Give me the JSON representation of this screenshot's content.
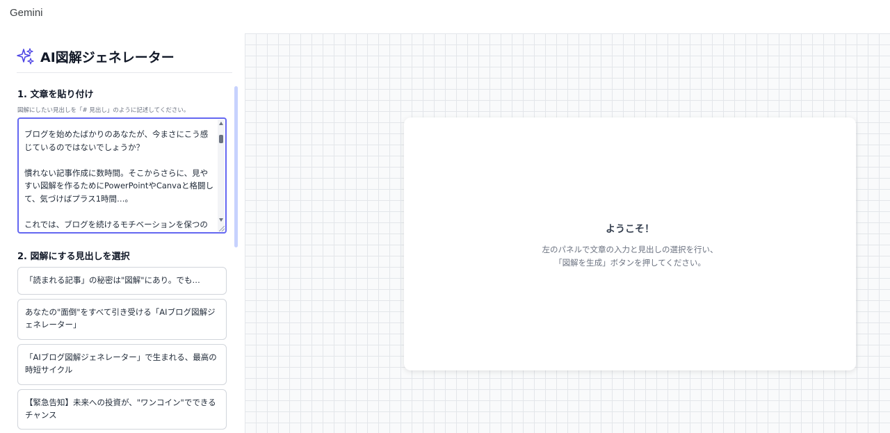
{
  "app": {
    "title": "Gemini"
  },
  "sidebar": {
    "title": "AI図解ジェネレーター",
    "section1": {
      "title": "1. 文章を貼り付け",
      "hint": "図解にしたい見出しを「# 見出し」のように記述してください。",
      "textarea_value": "ブログを始めたばかりのあなたが、今まさにこう感じているのではないでしょうか？\n\n慣れない記事作成に数時間。そこからさらに、見やすい図解を作るためにPowerPointやCanvaと格闘して、気づけばプラス1時間…。\n\nこれでは、ブログを続けるモチベーションを保つのが難しいですよね。"
    },
    "section2": {
      "title": "2. 図解にする見出しを選択",
      "headings": [
        "「読まれる記事」の秘密は\"図解\"にあり。でも…",
        "あなたの\"面倒\"をすべて引き受ける「AIブログ図解ジェネレーター」",
        "「AIブログ図解ジェネレーター」で生まれる、最高の時短サイクル",
        "【緊急告知】未来への投資が、\"ワンコイン\"でできるチャンス"
      ]
    }
  },
  "welcome": {
    "title": "ようこそ！",
    "line1": "左のパネルで文章の入力と見出しの選択を行い、",
    "line2": "「図解を生成」ボタンを押してください。"
  },
  "colors": {
    "accent": "#6366f1",
    "text": "#1f2937",
    "muted": "#6b7280"
  }
}
